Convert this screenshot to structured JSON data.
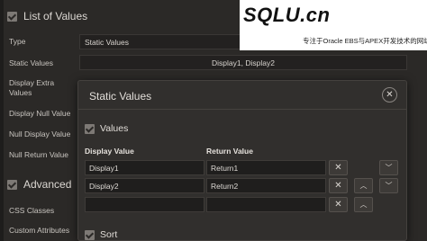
{
  "background_panel": {
    "groups": [
      {
        "title": "List of Values"
      },
      {
        "title": "Advanced"
      }
    ],
    "properties": [
      {
        "label": "Type",
        "value": "Static Values"
      },
      {
        "label": "Static Values",
        "value": "Display1, Display2"
      },
      {
        "label": "Display Extra Values",
        "value": ""
      },
      {
        "label": "Display Null Value",
        "value": ""
      },
      {
        "label": "Null Display Value",
        "value": ""
      },
      {
        "label": "Null Return Value",
        "value": ""
      }
    ],
    "advanced_properties": [
      {
        "label": "CSS Classes"
      },
      {
        "label": "Custom Attributes"
      }
    ]
  },
  "watermark": {
    "logo": "SQLU.cn",
    "subtitle": "专注于Oracle EBS与APEX开发技术的网站"
  },
  "dialog": {
    "title": "Static Values",
    "close_icon": "close-icon",
    "values_section": {
      "title": "Values",
      "columns": [
        "Display Value",
        "Return Value"
      ],
      "rows": [
        {
          "display": "Display1",
          "return": "Return1"
        },
        {
          "display": "Display2",
          "return": "Return2"
        },
        {
          "display": "",
          "return": ""
        }
      ]
    },
    "sort_section": {
      "title": "Sort"
    }
  },
  "colors": {
    "background": "#2b2927",
    "dialog": "#312f2d",
    "field": "#1f1e1d",
    "text": "#dedad5"
  }
}
